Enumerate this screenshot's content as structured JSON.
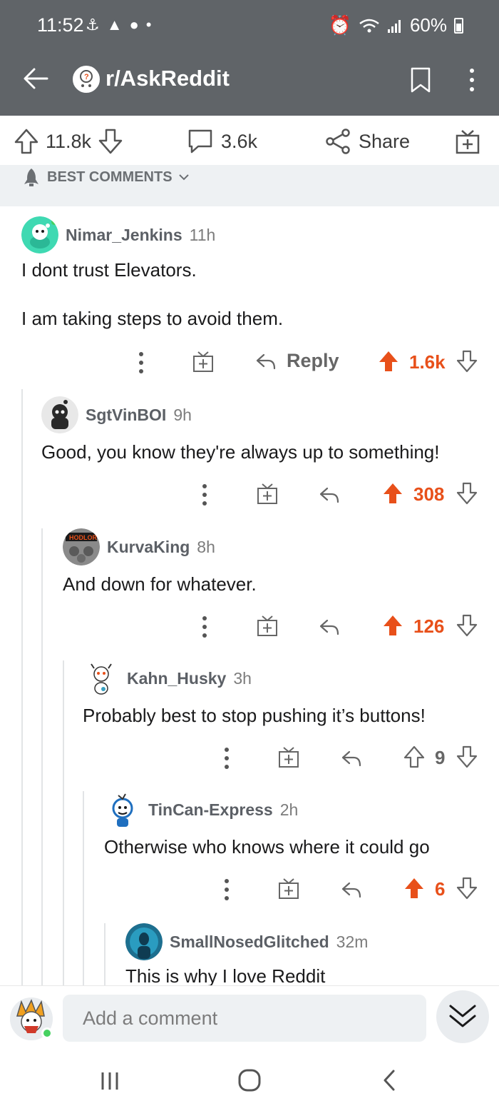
{
  "status_bar": {
    "time": "11:52",
    "battery": "60%"
  },
  "header": {
    "subreddit": "r/AskReddit"
  },
  "action_bar": {
    "upvotes": "11.8k",
    "comments": "3.6k",
    "share_label": "Share"
  },
  "sort": {
    "label": "BEST COMMENTS"
  },
  "comments": [
    {
      "username": "Nimar_Jenkins",
      "age": "11h",
      "body": "I dont trust Elevators.\n\nI am taking steps to avoid them.",
      "reply_label": "Reply",
      "score": "1.6k",
      "upvoted": true
    },
    {
      "username": "SgtVinBOI",
      "age": "9h",
      "body": "Good, you know they're always up to something!",
      "score": "308",
      "upvoted": true
    },
    {
      "username": "KurvaKing",
      "age": "8h",
      "body": "And down for whatever.",
      "score": "126",
      "upvoted": true
    },
    {
      "username": "Kahn_Husky",
      "age": "3h",
      "body": "Probably best to stop pushing it’s buttons!",
      "score": "9",
      "upvoted": false
    },
    {
      "username": "TinCan-Express",
      "age": "2h",
      "body": "Otherwise who knows where it could go",
      "score": "6",
      "upvoted": true
    },
    {
      "username": "SmallNosedGlitched",
      "age": "32m",
      "body": "This is why I love Reddit"
    }
  ],
  "composer": {
    "placeholder": "Add a comment"
  },
  "colors": {
    "header_bg": "#606468",
    "upvote_accent": "#e8501a",
    "online": "#46d160"
  }
}
